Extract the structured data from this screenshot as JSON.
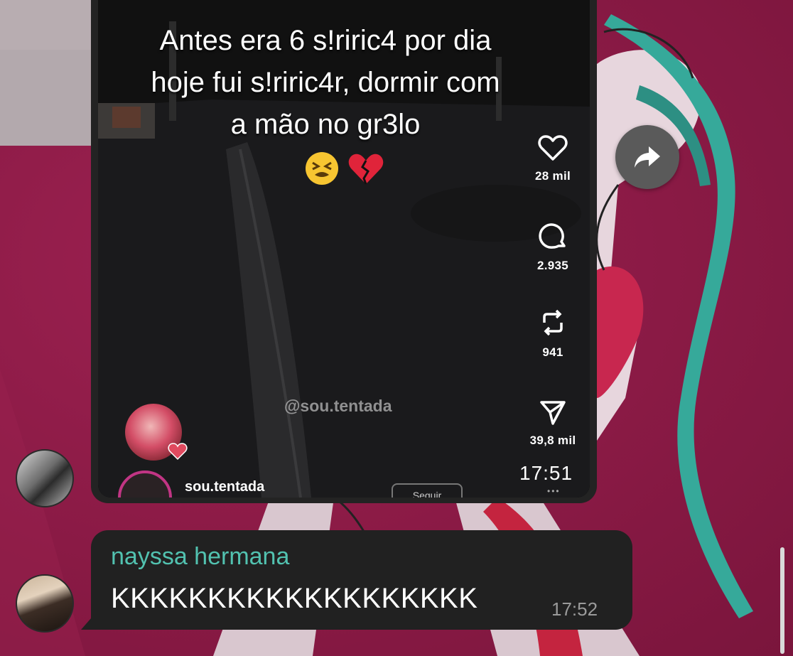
{
  "video_post": {
    "caption_lines": [
      "Antes era 6 s!riric4 por dia",
      "hoje fui s!riric4r, dormir com",
      "a mão no gr3lo"
    ],
    "emojis": [
      "tired-face-emoji",
      "broken-heart-emoji"
    ],
    "actions": {
      "likes": "28 mil",
      "comments": "2.935",
      "reposts": "941",
      "shares": "39,8 mil"
    },
    "watermark": "@sou.tentada",
    "username": "sou.tentada",
    "follow_label": "Seguir",
    "timestamp": "17:51"
  },
  "text_message": {
    "sender": "nayssa hermana",
    "text": "KKKKKKKKKKKKKKKKKKK",
    "timestamp": "17:52"
  },
  "colors": {
    "wallpaper": "#8e1c48",
    "bubble": "#212121",
    "sender_name": "#52c2b0",
    "time": "#9a9a9a"
  }
}
